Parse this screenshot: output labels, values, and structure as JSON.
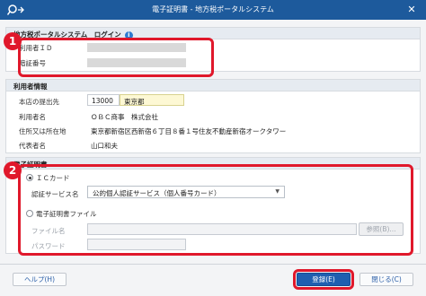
{
  "window": {
    "title": "電子証明書 - 地方税ポータルシステム",
    "close_glyph": "✕"
  },
  "login": {
    "heading": "地方税ポータルシステム　ログイン",
    "user_id_label": "利用者ＩＤ",
    "password_label": "暗証番号"
  },
  "user_info": {
    "heading": "利用者情報",
    "office_label": "本店の提出先",
    "office_code": "13000",
    "office_name": "東京都",
    "user_name_label": "利用者名",
    "user_name": "ＯＢＣ商事　株式会社",
    "address_label": "住所又は所在地",
    "address": "東京都新宿区西新宿６丁目８番１号住友不動産新宿オークタワー",
    "rep_label": "代表者名",
    "rep_name": "山口和夫"
  },
  "certificate": {
    "heading": "電子証明書",
    "ic_card_label": "ＩＣカード",
    "service_label": "認証サービス名",
    "service_value": "公的個人認証サービス（個人番号カード）",
    "file_option_label": "電子証明書ファイル",
    "file_name_label": "ファイル名",
    "browse_label": "参照(B)...",
    "password_label": "パスワード"
  },
  "footer": {
    "help_label": "ヘルプ(H)",
    "register_label": "登録(E)",
    "close_label": "閉じる(C)"
  },
  "callouts": {
    "one": "1",
    "two": "2"
  },
  "colors": {
    "titlebar": "#1d5a9c",
    "highlight": "#e0182b",
    "primary_button": "#1f5fb0"
  }
}
